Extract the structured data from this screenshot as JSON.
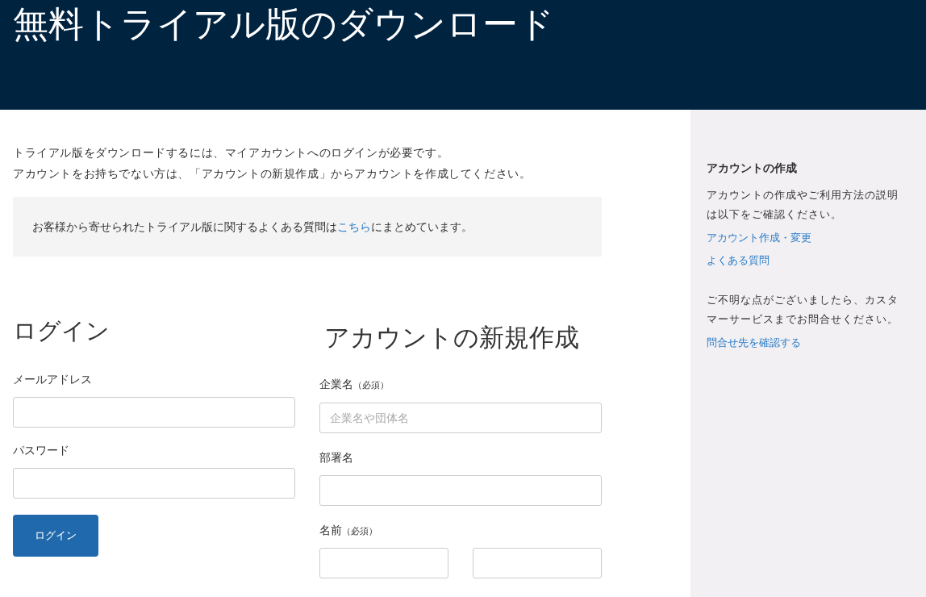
{
  "header": {
    "title": "無料トライアル版のダウンロード"
  },
  "intro": [
    "トライアル版をダウンロードするには、マイアカウントへのログインが必要です。",
    "アカウントをお持ちでない方は、「アカウントの新規作成」からアカウントを作成してください。"
  ],
  "faq_note": {
    "before": "お客様から寄せられたトライアル版に関するよくある質問は",
    "link": "こちら",
    "after": "にまとめています。"
  },
  "login": {
    "title": "ログイン",
    "fields": [
      {
        "label": "メールアドレス"
      },
      {
        "label": "パスワード"
      }
    ],
    "button": "ログイン"
  },
  "signup": {
    "title": "アカウントの新規作成",
    "fields": [
      {
        "label": "企業名",
        "required": "（必須）",
        "kind": "single",
        "placeholder": "企業名や団体名"
      },
      {
        "label": "部署名",
        "kind": "single"
      },
      {
        "label": "名前",
        "required": "（必須）",
        "kind": "pair"
      }
    ]
  },
  "sidebar": {
    "title": "アカウントの作成",
    "blocks": [
      {
        "text": "アカウントの作成やご利用方法の説明は以下をご確認ください。",
        "links": [
          "アカウント作成・変更",
          "よくある質問"
        ]
      },
      {
        "text": "ご不明な点がございましたら、カスタマーサービスまでお問合せください。",
        "links": [
          "問合せ先を確認する"
        ]
      }
    ]
  }
}
